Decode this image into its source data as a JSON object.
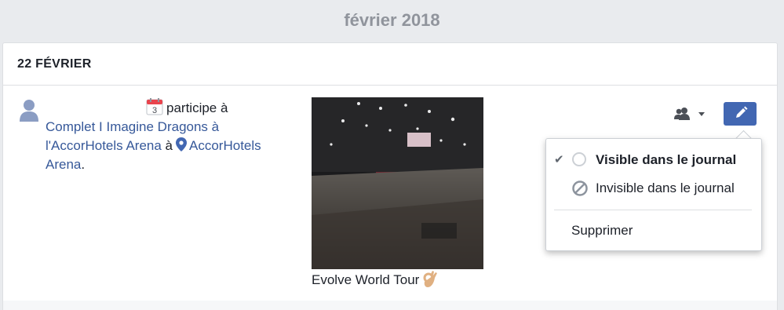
{
  "timeline": {
    "month_header": "février 2018",
    "date_label": "22 FÉVRIER"
  },
  "activity": {
    "calendar_day": "3",
    "verb": "participe à",
    "event_name": "Complet I Imagine Dragons à l'AccorHotels Arena",
    "preposition": "à",
    "place_name": "AccorHotels Arena",
    "period": "."
  },
  "photo": {
    "caption": "Evolve World Tour"
  },
  "colors": {
    "link": "#365899",
    "accent": "#4267b2",
    "header_text": "#90949c"
  },
  "icons": {
    "avatar": "person-silhouette-icon",
    "calendar": "calendar-icon",
    "pin": "location-pin-icon",
    "audience": "friends-icon",
    "edit": "pencil-icon",
    "emoji": "ok-hand-emoji"
  },
  "menu": {
    "visible_label": "Visible dans le journal",
    "hidden_label": "Invisible dans le journal",
    "delete_label": "Supprimer",
    "check_glyph": "✔"
  }
}
